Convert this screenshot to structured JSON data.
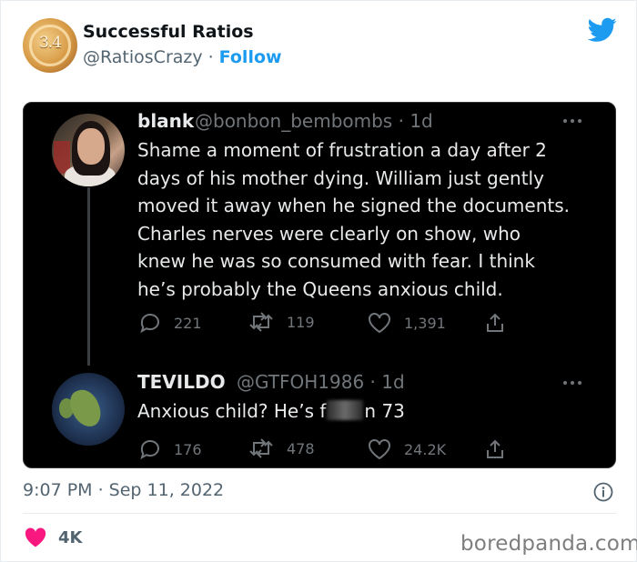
{
  "author": {
    "avatar_text": "3.4",
    "display_name": "Successful Ratios",
    "handle": "@RatiosCrazy",
    "follow_label": "Follow"
  },
  "embedded": {
    "reply": {
      "name": "blank",
      "handle": "@bonbon_bembombs",
      "time": "1d",
      "text": "Shame a moment of frustration a day after 2 days of his mother dying. William just gently moved it away when he signed the documents. Charles nerves were clearly on show, who knew he was so consumed with fear. I think he’s probably the Queens anxious child.",
      "replies": "221",
      "retweets": "119",
      "likes": "1,391"
    },
    "quote": {
      "name": "TEVILDO",
      "handle": "@GTFOH1986",
      "time": "1d",
      "text_before": "Anxious child? He’s f",
      "text_after": "n 73",
      "replies": "176",
      "retweets": "478",
      "likes": "24.2K"
    }
  },
  "footer": {
    "timestamp": "9:07 PM · Sep 11, 2022",
    "likes": "4K",
    "watermark": "boredpanda.com"
  },
  "colors": {
    "twitter_blue": "#1d9bf0",
    "like_red": "#f91880",
    "card_bg": "#000000"
  }
}
